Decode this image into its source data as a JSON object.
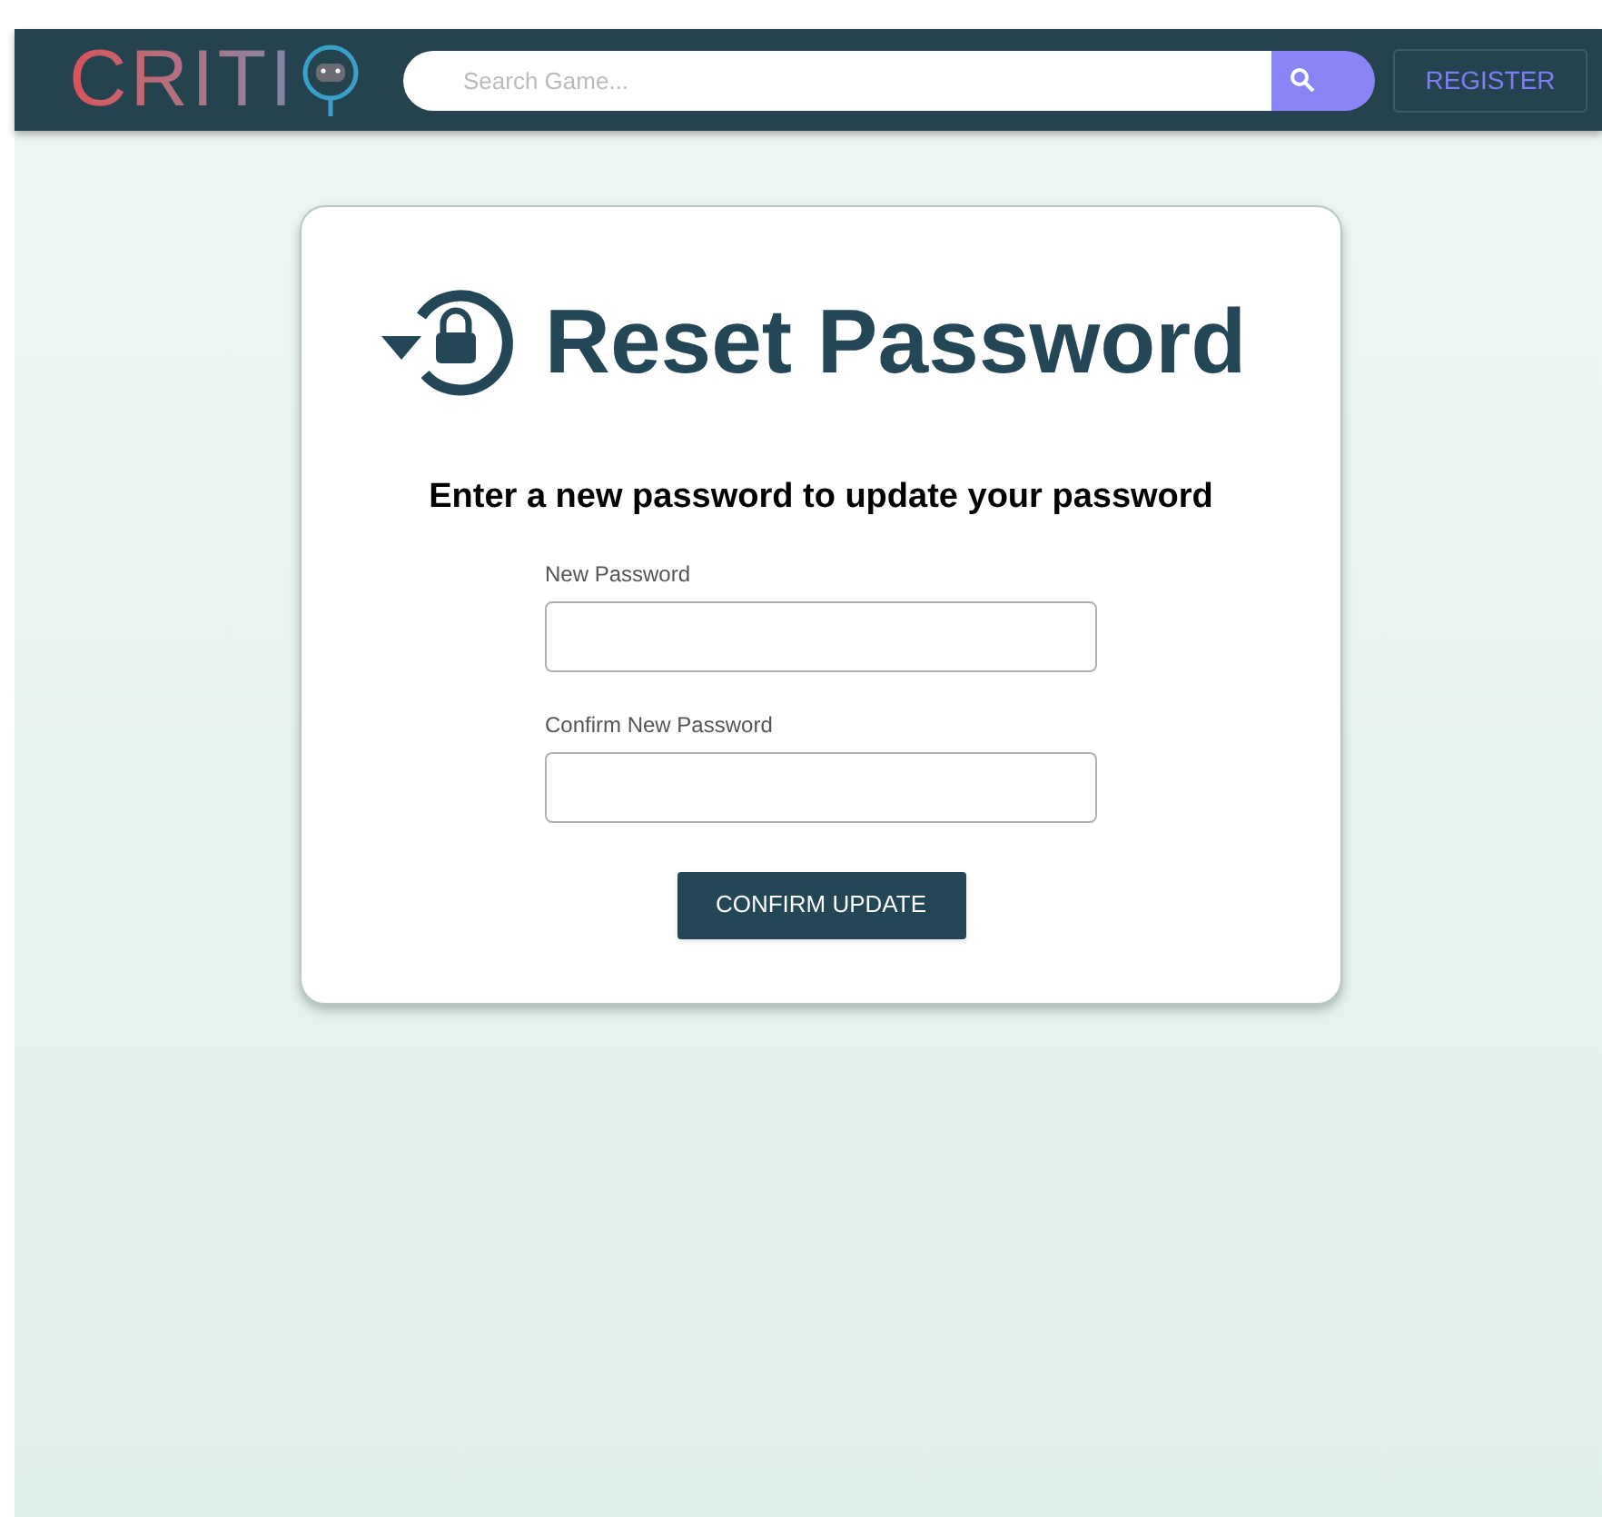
{
  "navbar": {
    "logo": "CRITI",
    "search": {
      "placeholder": "Search Game..."
    },
    "register": "REGISTER"
  },
  "card": {
    "title": "Reset Password",
    "subtitle": "Enter a new password to update your password",
    "fields": [
      {
        "label": "New Password"
      },
      {
        "label": "Confirm New Password"
      }
    ],
    "submit": "CONFIRM UPDATE"
  }
}
